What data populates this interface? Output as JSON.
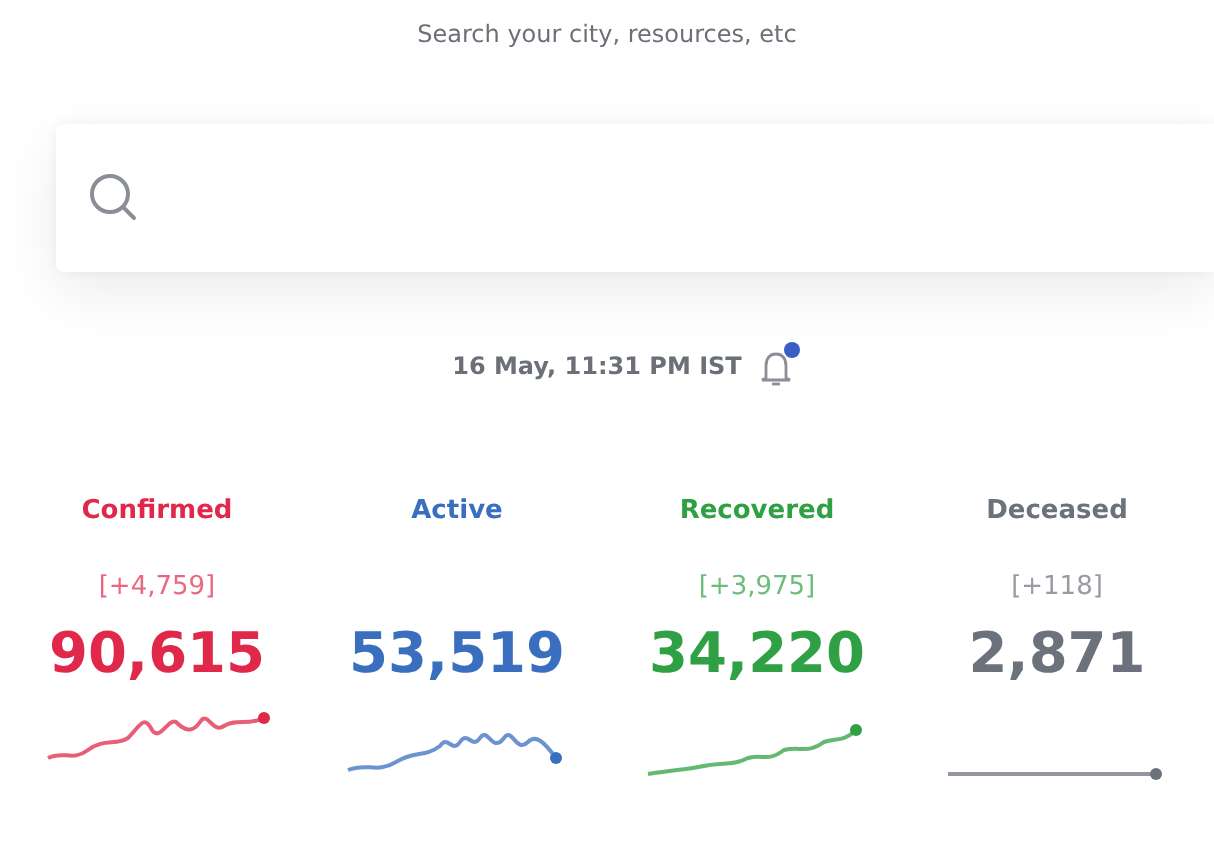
{
  "header": {
    "hint": "Search your city, resources, etc"
  },
  "timestamp": "16 May, 11:31 PM IST",
  "notifications": {
    "unread": true
  },
  "stats": [
    {
      "label": "Confirmed",
      "delta": "[+4,759]",
      "value": "90,615",
      "color": "#e0284a"
    },
    {
      "label": "Active",
      "value": "53,519",
      "color": "#3a6fc0"
    },
    {
      "label": "Recovered",
      "delta": "[+3,975]",
      "value": "34,220",
      "color": "#2fa043"
    },
    {
      "label": "Deceased",
      "delta": "[+118]",
      "value": "2,871",
      "color": "#6c727c"
    }
  ]
}
